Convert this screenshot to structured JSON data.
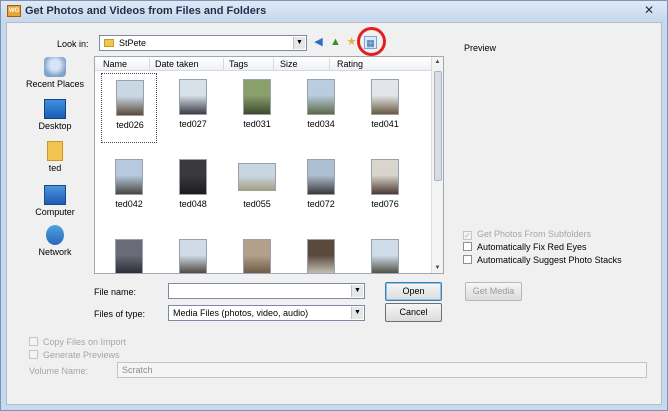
{
  "window": {
    "title": "Get Photos and Videos from Files and Folders",
    "app_icon_text": "WG",
    "close_glyph": "✕"
  },
  "lookin": {
    "label": "Look in:",
    "value": "StPete"
  },
  "toolbar": {
    "back_glyph": "◀",
    "up_glyph": "▲",
    "newfolder_glyph": "★",
    "views_glyph": "▦",
    "highlight_color": "#e02020"
  },
  "preview": {
    "label": "Preview"
  },
  "places": [
    {
      "label": "Recent Places",
      "icon": "recent-places-icon"
    },
    {
      "label": "Desktop",
      "icon": "desktop-icon"
    },
    {
      "label": "ted",
      "icon": "user-folder-icon"
    },
    {
      "label": "Computer",
      "icon": "computer-icon"
    },
    {
      "label": "Network",
      "icon": "network-icon"
    }
  ],
  "columns": [
    "Name",
    "Date taken",
    "Tags",
    "Size",
    "Rating"
  ],
  "files": [
    {
      "name": "ted026",
      "selected": true,
      "orientation": "portrait",
      "colors": [
        "#c9d6e3",
        "#5a4a3a"
      ]
    },
    {
      "name": "ted027",
      "orientation": "portrait",
      "colors": [
        "#d7e1ea",
        "#3c3c46"
      ]
    },
    {
      "name": "ted031",
      "orientation": "portrait",
      "colors": [
        "#8aa06a",
        "#3e4a30"
      ]
    },
    {
      "name": "ted034",
      "orientation": "portrait",
      "colors": [
        "#b9cce0",
        "#5d6a48"
      ]
    },
    {
      "name": "ted041",
      "orientation": "portrait",
      "colors": [
        "#e2e6ea",
        "#6a5a3e"
      ]
    },
    {
      "name": "ted042",
      "orientation": "portrait",
      "colors": [
        "#b6c9de",
        "#4a4642"
      ]
    },
    {
      "name": "ted048",
      "orientation": "portrait",
      "colors": [
        "#3a3a3e",
        "#1c1c1e"
      ]
    },
    {
      "name": "ted055",
      "orientation": "landscape",
      "colors": [
        "#c8d6e4",
        "#a8a084"
      ]
    },
    {
      "name": "ted072",
      "orientation": "portrait",
      "colors": [
        "#aebfd1",
        "#3a3838"
      ]
    },
    {
      "name": "ted076",
      "orientation": "portrait",
      "colors": [
        "#d9d4cc",
        "#4a3a30"
      ]
    },
    {
      "name": "",
      "orientation": "portrait",
      "colors": [
        "#6a6a78",
        "#2a2a34"
      ]
    },
    {
      "name": "",
      "orientation": "portrait",
      "colors": [
        "#cfdbe6",
        "#4a4038"
      ]
    },
    {
      "name": "",
      "orientation": "portrait",
      "colors": [
        "#b2a08a",
        "#6a5848"
      ]
    },
    {
      "name": "",
      "orientation": "portrait",
      "colors": [
        "#5a4a3e",
        "#c9c4b8"
      ]
    },
    {
      "name": "",
      "orientation": "portrait",
      "colors": [
        "#cfdcea",
        "#4a4a3a"
      ]
    }
  ],
  "form": {
    "filename_label": "File name:",
    "filename_value": "",
    "filetype_label": "Files of type:",
    "filetype_value": "Media Files (photos, video, audio)",
    "open_label": "Open",
    "cancel_label": "Cancel",
    "dropdown_glyph": "▼"
  },
  "options": {
    "get_media_label": "Get Media",
    "subfolders": {
      "label": "Get Photos From Subfolders",
      "checked": true,
      "enabled": false
    },
    "red_eyes": {
      "label": "Automatically Fix Red Eyes",
      "checked": false,
      "enabled": true
    },
    "stacks": {
      "label": "Automatically Suggest Photo Stacks",
      "checked": false,
      "enabled": true
    }
  },
  "import": {
    "copy_files": {
      "label": "Copy Files on Import",
      "checked": false
    },
    "previews": {
      "label": "Generate Previews",
      "checked": false
    },
    "volume_label": "Volume Name:",
    "volume_value": "Scratch"
  }
}
